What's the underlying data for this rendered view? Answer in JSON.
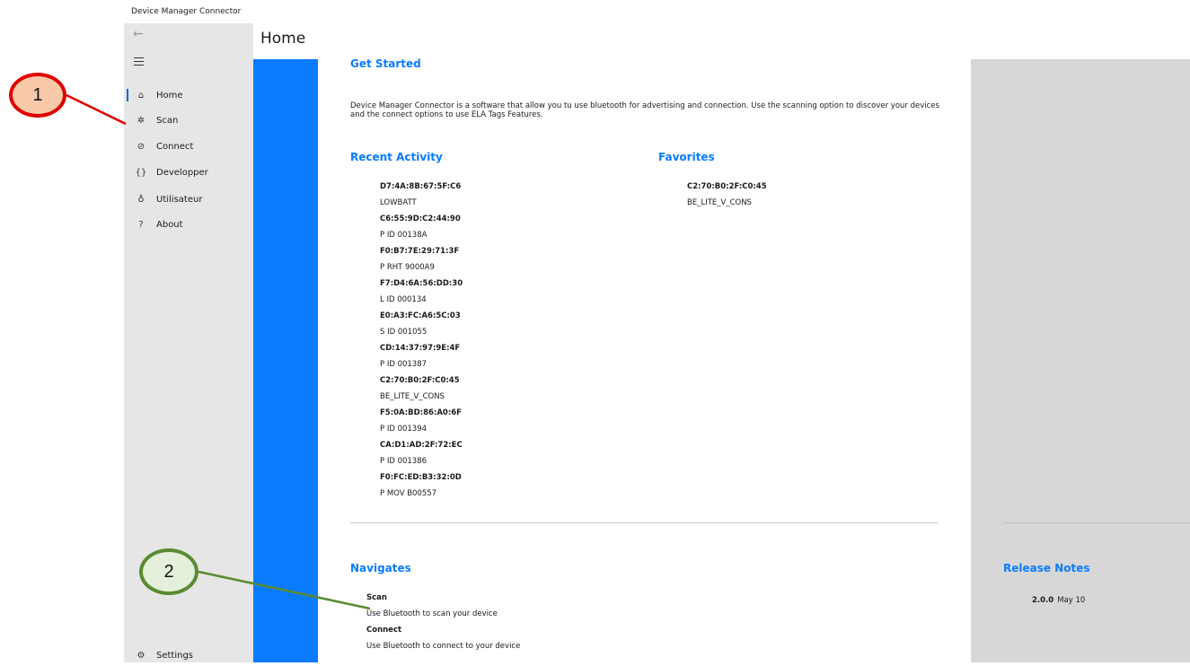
{
  "app": {
    "title": "Device Manager Connector"
  },
  "sidebar": {
    "items": [
      {
        "icon": "home-icon",
        "glyph": "⌂",
        "label": "Home",
        "active": true
      },
      {
        "icon": "scan-icon",
        "glyph": "✲",
        "label": "Scan"
      },
      {
        "icon": "connect-icon",
        "glyph": "⊘",
        "label": "Connect"
      },
      {
        "icon": "braces-icon",
        "glyph": "{}",
        "label": "Developper"
      },
      {
        "icon": "user-icon",
        "glyph": "♁",
        "label": "Utilisateur"
      },
      {
        "icon": "about-icon",
        "glyph": "?",
        "label": "About"
      }
    ],
    "settings": {
      "icon": "gear-icon",
      "glyph": "⚙",
      "label": "Settings"
    }
  },
  "page": {
    "title": "Home"
  },
  "get_started": {
    "heading": "Get Started",
    "text": "Device Manager Connector is a software that allow you tu use bluetooth for advertising and connection. Use the scanning option to discover your devices and the connect options to use ELA Tags Features."
  },
  "recent_activity": {
    "heading": "Recent Activity",
    "items": [
      {
        "mac": "D7:4A:8B:67:5F:C6",
        "name": "LOWBATT"
      },
      {
        "mac": "C6:55:9D:C2:44:90",
        "name": "P ID 00138A"
      },
      {
        "mac": "F0:B7:7E:29:71:3F",
        "name": "P RHT 9000A9"
      },
      {
        "mac": "F7:D4:6A:56:DD:30",
        "name": "L ID 000134"
      },
      {
        "mac": "E0:A3:FC:A6:5C:03",
        "name": "S ID 001055"
      },
      {
        "mac": "CD:14:37:97:9E:4F",
        "name": "P ID 001387"
      },
      {
        "mac": "C2:70:B0:2F:C0:45",
        "name": "BE_LITE_V_CONS"
      },
      {
        "mac": "F5:0A:BD:86:A0:6F",
        "name": "P ID 001394"
      },
      {
        "mac": "CA:D1:AD:2F:72:EC",
        "name": "P ID 001386"
      },
      {
        "mac": "F0:FC:ED:B3:32:0D",
        "name": "P MOV B00557"
      }
    ]
  },
  "favorites": {
    "heading": "Favorites",
    "items": [
      {
        "mac": "C2:70:B0:2F:C0:45",
        "name": "BE_LITE_V_CONS"
      }
    ]
  },
  "navigates": {
    "heading": "Navigates",
    "links": [
      {
        "title": "Scan",
        "description": "Use Bluetooth to scan your device"
      },
      {
        "title": "Connect",
        "description": "Use Bluetooth to connect to your device"
      }
    ]
  },
  "release_notes": {
    "heading": "Release Notes",
    "version": "2.0.0",
    "date": "May 10"
  },
  "callouts": [
    {
      "number": "1",
      "border_color": "#e00000",
      "fill_color": "#f8c9a9"
    },
    {
      "number": "2",
      "border_color": "#5b8a32",
      "fill_color": "#e4efdc"
    }
  ],
  "colors": {
    "accent": "#0a7bff",
    "sidebar_bg": "#e6e6e6",
    "right_panel_bg": "#d7d7d7"
  }
}
